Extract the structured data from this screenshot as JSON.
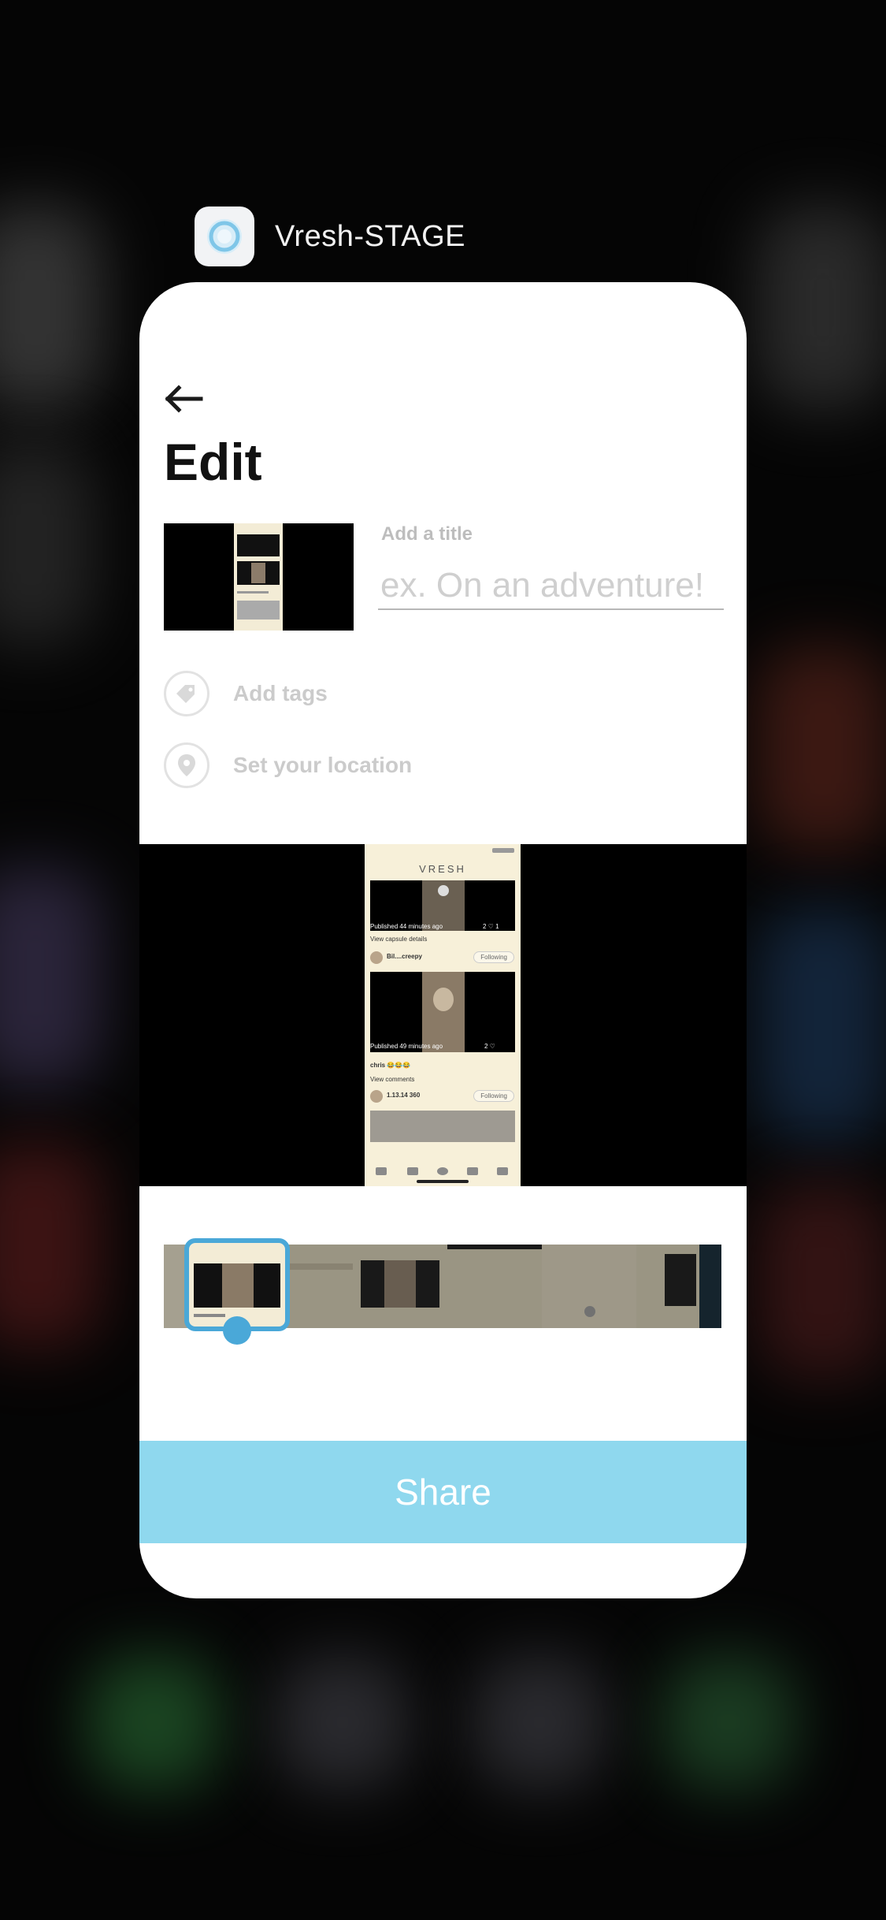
{
  "app_switcher": {
    "app_name": "Vresh-STAGE",
    "app_icon": "vresh-ring-icon"
  },
  "edit_screen": {
    "back_icon": "arrow-left-icon",
    "title": "Edit",
    "title_field": {
      "label": "Add a title",
      "placeholder": "ex. On an adventure!",
      "value": ""
    },
    "options": [
      {
        "icon": "tag-icon",
        "label": "Add tags"
      },
      {
        "icon": "location-pin-icon",
        "label": "Set your location"
      }
    ],
    "share_label": "Share"
  },
  "preview_screen": {
    "logo": "VRESH",
    "post1_meta": "Published 44 minutes ago",
    "post1_counts": "2 ♡ 1",
    "link1": "View capsule details",
    "user2": "Bil....creepy",
    "follow_label": "Following",
    "post2_meta": "Published 49 minutes ago",
    "post2_counts": "2 ♡",
    "caption": "chris 😂😂😂",
    "link2": "View comments",
    "user3": "1.13.14 360"
  },
  "colors": {
    "accent": "#4aa8d8",
    "share_bg": "#8fd8ee",
    "card_bg": "#ffffff",
    "background": "#050505"
  }
}
